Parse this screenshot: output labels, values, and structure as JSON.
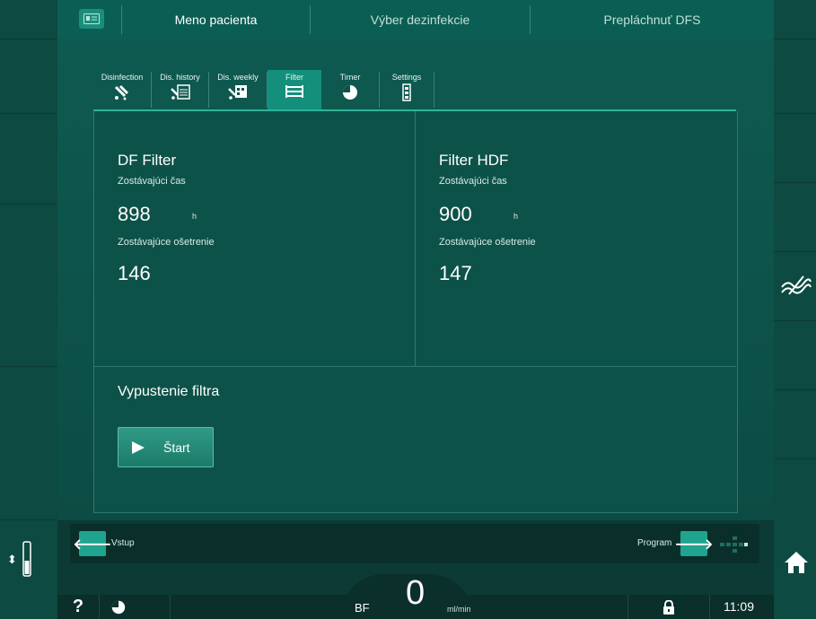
{
  "topbar": {
    "tabs": [
      "Meno pacienta",
      "Výber dezinfekcie",
      "Prepláchnuť DFS"
    ],
    "card_icon": "id-card-icon"
  },
  "subtabs": [
    {
      "label": "Disinfection",
      "icon": "disinfection-icon"
    },
    {
      "label": "Dis. history",
      "icon": "dis-history-icon"
    },
    {
      "label": "Dis. weekly",
      "icon": "dis-weekly-icon"
    },
    {
      "label": "Filter",
      "icon": "filter-icon",
      "active": true
    },
    {
      "label": "Timer",
      "icon": "timer-icon"
    },
    {
      "label": "Settings",
      "icon": "settings-icon"
    }
  ],
  "filters": {
    "df": {
      "title": "DF Filter",
      "time_label": "Zostávajúci čas",
      "time_value": "898",
      "time_unit": "h",
      "treat_label": "Zostávajúce ošetrenie",
      "treat_value": "146"
    },
    "hdf": {
      "title": "Filter HDF",
      "time_label": "Zostávajúci čas",
      "time_value": "900",
      "time_unit": "h",
      "treat_label": "Zostávajúce ošetrenie",
      "treat_value": "147"
    }
  },
  "drain": {
    "title": "Vypustenie filtra",
    "start_label": "Štart"
  },
  "nav": {
    "back_label": "Vstup",
    "forward_label": "Program"
  },
  "status": {
    "help": "?",
    "bf_label": "BF",
    "bf_value": "0",
    "bf_unit": "ml/min",
    "time": "11:09"
  },
  "colors": {
    "accent": "#1fa48f",
    "active_tab": "#138f7c",
    "background": "#0b3b34"
  }
}
